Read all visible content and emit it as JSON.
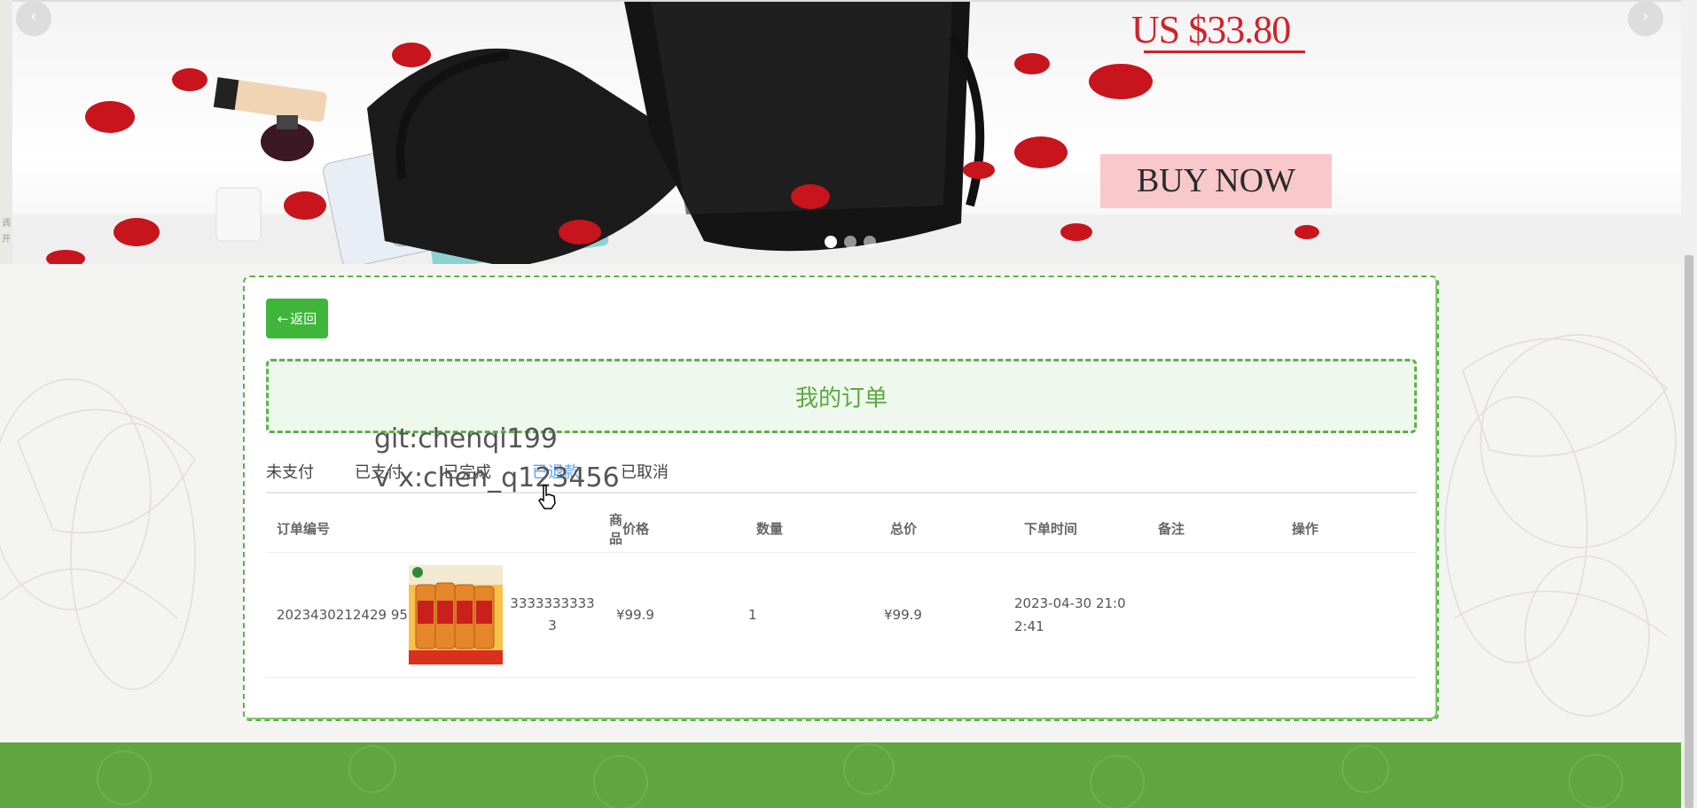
{
  "banner": {
    "price": "US $33.80",
    "buy_now": "BUY NOW",
    "prev_arrow": "‹",
    "next_arrow": "›",
    "left_strip_text": [
      "调",
      "开"
    ],
    "slides": 3,
    "active_slide": 1
  },
  "order_page": {
    "back_label": "返回",
    "title": "我的订单",
    "tabs": [
      "未支付",
      "已支付",
      "已完成",
      "已退款",
      "已取消"
    ],
    "active_tab": "已退款",
    "columns": [
      "订单编号",
      "商品",
      "价格",
      "数量",
      "总价",
      "下单时间",
      "备注",
      "操作"
    ],
    "rows": [
      {
        "order_no": "2023430212429 95",
        "product_name": "3333333333 3",
        "price": "¥99.9",
        "quantity": "1",
        "total": "¥99.9",
        "order_time": "2023-04-30 21:0 2:41",
        "remark": "",
        "action": ""
      }
    ]
  },
  "watermark": {
    "line1": "git:chenqi199",
    "line2": "v x:chen_q123456"
  },
  "colors": {
    "accent_green": "#3fb53a",
    "border_green": "#5bb246",
    "active_tab_blue": "#58a3f1",
    "price_red": "#d0222b",
    "footer_green": "#5fa540"
  }
}
